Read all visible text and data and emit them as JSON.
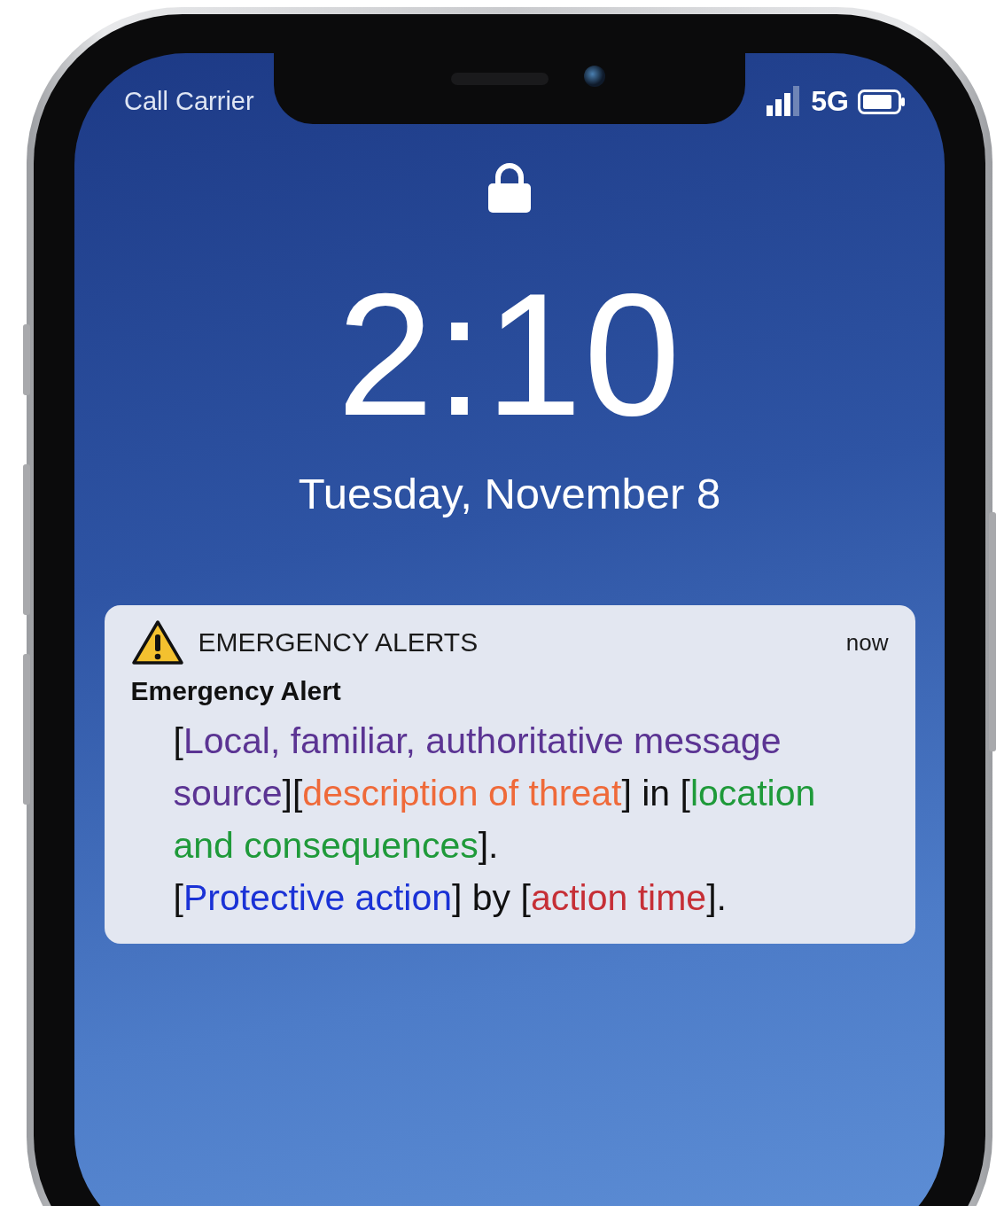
{
  "status_bar": {
    "carrier": "Call Carrier",
    "network": "5G"
  },
  "lock_screen": {
    "time": "2:10",
    "date": "Tuesday, November 8"
  },
  "notification": {
    "app": "EMERGENCY ALERTS",
    "timestamp": "now",
    "title": "Emergency Alert",
    "paragraphs": [
      {
        "segments": [
          {
            "text": "[",
            "color": "#111111"
          },
          {
            "text": "Local, familiar, authoritative message source",
            "color": "#5b3493"
          },
          {
            "text": "][",
            "color": "#111111"
          },
          {
            "text": "description of threat",
            "color": "#ef6a3a"
          },
          {
            "text": "] in [",
            "color": "#111111"
          },
          {
            "text": "location and consequences",
            "color": "#1f9a3a"
          },
          {
            "text": "].",
            "color": "#111111"
          }
        ]
      },
      {
        "segments": [
          {
            "text": "[",
            "color": "#111111"
          },
          {
            "text": "Protective action",
            "color": "#1a32d6"
          },
          {
            "text": "] by [",
            "color": "#111111"
          },
          {
            "text": "action time",
            "color": "#c62f36"
          },
          {
            "text": "].",
            "color": "#111111"
          }
        ]
      }
    ]
  }
}
